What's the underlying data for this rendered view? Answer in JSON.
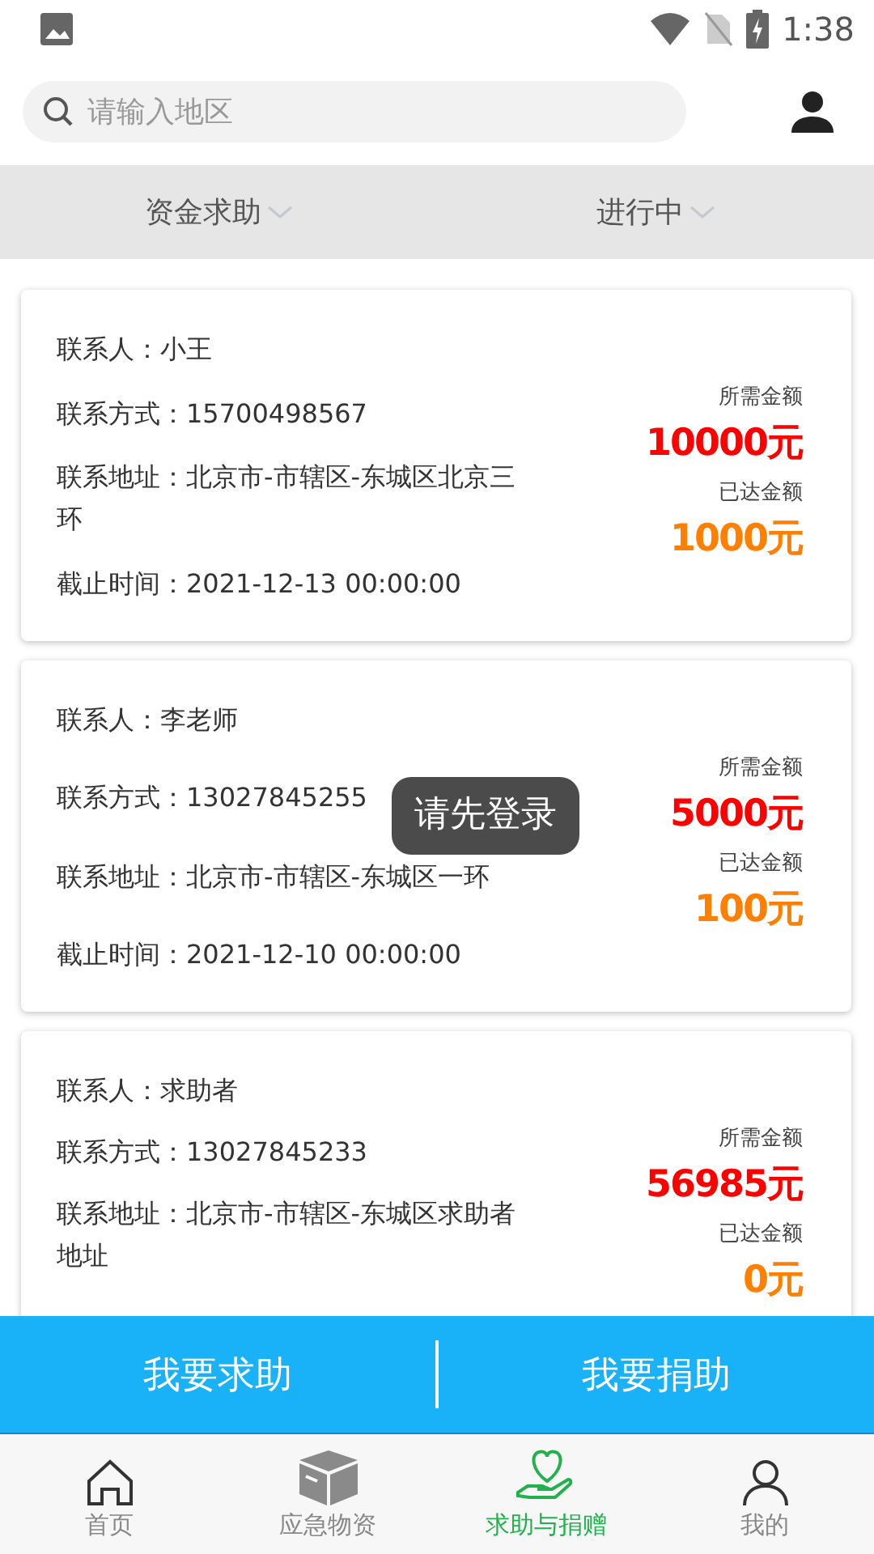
{
  "status_bar": {
    "time": "1:38"
  },
  "search": {
    "placeholder": "请输入地区"
  },
  "filters": [
    {
      "label": "资金求助"
    },
    {
      "label": "进行中"
    }
  ],
  "cards": [
    {
      "contact": "联系人：小王",
      "phone": "联系方式：15700498567",
      "address": "联系地址：北京市-市辖区-东城区北京三环",
      "deadline": "截止时间：2021-12-13 00:00:00",
      "need_label": "所需金额",
      "need": "10000元",
      "reached_label": "已达金额",
      "reached": "1000元"
    },
    {
      "contact": "联系人：李老师",
      "phone": "联系方式：13027845255",
      "address": "联系地址：北京市-市辖区-东城区一环",
      "deadline": "截止时间：2021-12-10 00:00:00",
      "need_label": "所需金额",
      "need": "5000元",
      "reached_label": "已达金额",
      "reached": "100元"
    },
    {
      "contact": "联系人：求助者",
      "phone": "联系方式：13027845233",
      "address": "联系地址：北京市-市辖区-东城区求助者地址",
      "need_label": "所需金额",
      "need": "56985元",
      "reached_label": "已达金额",
      "reached": "0元"
    }
  ],
  "toast": "请先登录",
  "actions": [
    "我要求助",
    "我要捐助"
  ],
  "nav": [
    {
      "label": "首页",
      "kind": "home",
      "selected": false
    },
    {
      "label": "应急物资",
      "kind": "box",
      "selected": false
    },
    {
      "label": "求助与捐赠",
      "kind": "heart",
      "selected": true
    },
    {
      "label": "我的",
      "kind": "person",
      "selected": false
    }
  ]
}
